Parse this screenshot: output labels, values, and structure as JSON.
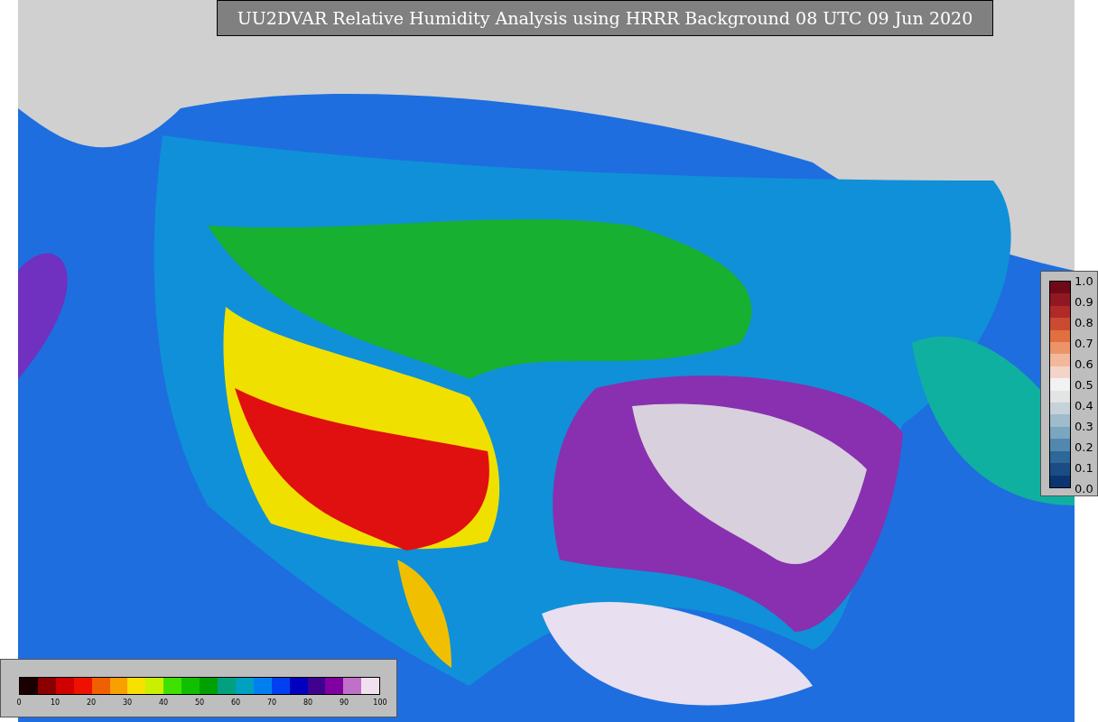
{
  "title": "UU2DVAR Relative Humidity Analysis using HRRR Background 08 UTC 09 Jun 2020",
  "legend_bottom": {
    "ticks": [
      "0",
      "10",
      "20",
      "30",
      "40",
      "50",
      "60",
      "70",
      "80",
      "90",
      "100"
    ],
    "swatches": [
      {
        "color": "#1a0000"
      },
      {
        "color": "#8a0000"
      },
      {
        "color": "#d00000"
      },
      {
        "color": "#f01000"
      },
      {
        "color": "#f06000"
      },
      {
        "color": "#f8a000"
      },
      {
        "color": "#f8e000"
      },
      {
        "color": "#c8f000"
      },
      {
        "color": "#40e000"
      },
      {
        "color": "#10c000"
      },
      {
        "color": "#00a000"
      },
      {
        "color": "#00a080"
      },
      {
        "color": "#00a0c0"
      },
      {
        "color": "#0080f0"
      },
      {
        "color": "#0040f0"
      },
      {
        "color": "#0000c0"
      },
      {
        "color": "#400090"
      },
      {
        "color": "#8000a0"
      },
      {
        "color": "#c070c8"
      },
      {
        "color": "#f0e0f0"
      }
    ]
  },
  "legend_right": {
    "ticks": [
      "1.0",
      "0.9",
      "0.8",
      "0.7",
      "0.6",
      "0.5",
      "0.4",
      "0.3",
      "0.2",
      "0.1",
      "0.0"
    ],
    "swatches": [
      {
        "color": "#6e0a18"
      },
      {
        "color": "#8f1822"
      },
      {
        "color": "#b02a2a"
      },
      {
        "color": "#cc4a32"
      },
      {
        "color": "#e07040"
      },
      {
        "color": "#ec9468"
      },
      {
        "color": "#f2b89c"
      },
      {
        "color": "#f4d4c8"
      },
      {
        "color": "#f2f2f2"
      },
      {
        "color": "#e2e4e6"
      },
      {
        "color": "#c6d2d8"
      },
      {
        "color": "#a0bccb"
      },
      {
        "color": "#7aa6bf"
      },
      {
        "color": "#5288ae"
      },
      {
        "color": "#2e6898"
      },
      {
        "color": "#1a4c86"
      },
      {
        "color": "#0b3570"
      }
    ]
  }
}
